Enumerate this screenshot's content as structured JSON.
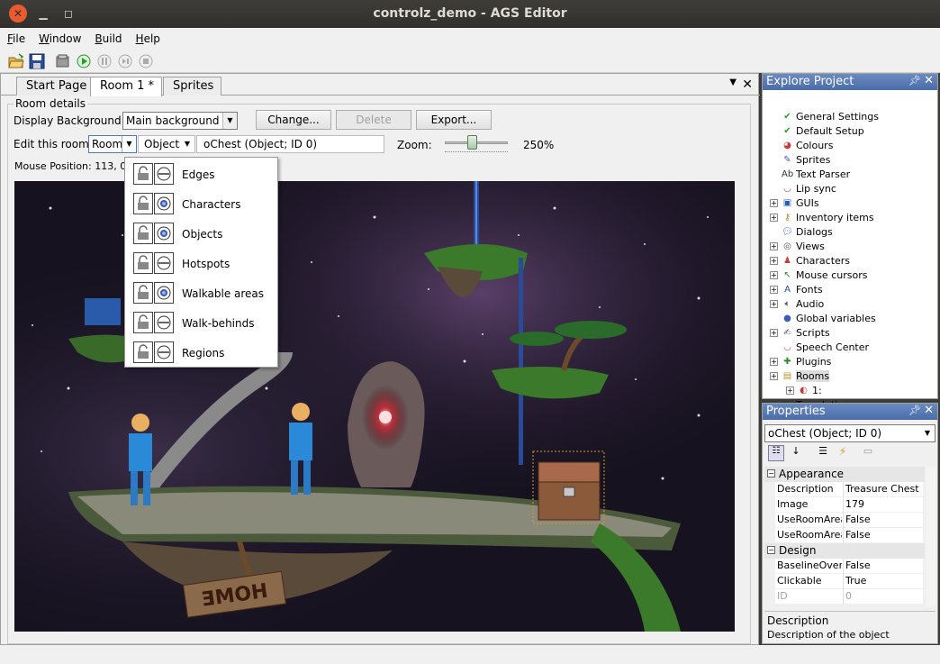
{
  "window": {
    "title": "controlz_demo - AGS Editor"
  },
  "menu": {
    "items": [
      "File",
      "Window",
      "Build",
      "Help"
    ]
  },
  "tabs": [
    {
      "label": "Start Page"
    },
    {
      "label": "Room 1 *"
    },
    {
      "label": "Sprites"
    }
  ],
  "room": {
    "group_label": "Room details",
    "display_bg_label": "Display Background:",
    "display_bg_value": "Main background",
    "change_label": "Change...",
    "delete_label": "Delete",
    "export_label": "Export...",
    "edit_label": "Edit this room's:",
    "edit_layer": "Room",
    "edit_filter": "Objects",
    "selected_object": "oChest (Object; ID 0)",
    "zoom_label": "Zoom:",
    "zoom_value": "250%",
    "zoom_fraction": 0.42,
    "mouse_position": "Mouse Position: 113, 0"
  },
  "layer_menu": [
    {
      "label": "Edges",
      "visible": false
    },
    {
      "label": "Characters",
      "visible": true
    },
    {
      "label": "Objects",
      "visible": true
    },
    {
      "label": "Hotspots",
      "visible": false
    },
    {
      "label": "Walkable areas",
      "visible": true
    },
    {
      "label": "Walk-behinds",
      "visible": false
    },
    {
      "label": "Regions",
      "visible": false
    }
  ],
  "scene": {
    "sign_text": "HOME"
  },
  "explore": {
    "title": "Explore Project",
    "items": [
      {
        "label": "General Settings",
        "icon": "check-icon",
        "expander": false,
        "indent": 0
      },
      {
        "label": "Default Setup",
        "icon": "check-icon",
        "expander": false,
        "indent": 0
      },
      {
        "label": "Colours",
        "icon": "palette-icon",
        "expander": false,
        "indent": 0
      },
      {
        "label": "Sprites",
        "icon": "sprite-icon",
        "expander": false,
        "indent": 0
      },
      {
        "label": "Text Parser",
        "icon": "text-icon",
        "expander": false,
        "indent": 0
      },
      {
        "label": "Lip sync",
        "icon": "lips-icon",
        "expander": false,
        "indent": 0
      },
      {
        "label": "GUIs",
        "icon": "gui-icon",
        "expander": true,
        "indent": 0
      },
      {
        "label": "Inventory items",
        "icon": "key-icon",
        "expander": true,
        "indent": 0
      },
      {
        "label": "Dialogs",
        "icon": "speech-icon",
        "expander": false,
        "indent": 0
      },
      {
        "label": "Views",
        "icon": "eyes-icon",
        "expander": true,
        "indent": 0
      },
      {
        "label": "Characters",
        "icon": "people-icon",
        "expander": true,
        "indent": 0
      },
      {
        "label": "Mouse cursors",
        "icon": "cursor-icon",
        "expander": true,
        "indent": 0
      },
      {
        "label": "Fonts",
        "icon": "font-icon",
        "expander": true,
        "indent": 0
      },
      {
        "label": "Audio",
        "icon": "speaker-icon",
        "expander": true,
        "indent": 0
      },
      {
        "label": "Global variables",
        "icon": "globe-icon",
        "expander": false,
        "indent": 0
      },
      {
        "label": "Scripts",
        "icon": "script-icon",
        "expander": true,
        "indent": 0
      },
      {
        "label": "Speech Center",
        "icon": "speech-center-icon",
        "expander": false,
        "indent": 0
      },
      {
        "label": "Plugins",
        "icon": "plugin-icon",
        "expander": true,
        "indent": 0
      },
      {
        "label": "Rooms",
        "icon": "box-icon",
        "expander": true,
        "indent": 0
      },
      {
        "label": "1:",
        "icon": "room-icon",
        "expander": true,
        "indent": 1
      },
      {
        "label": "Translations",
        "icon": "translate-icon",
        "expander": false,
        "indent": 0
      }
    ]
  },
  "properties": {
    "title": "Properties",
    "object_select": "oChest (Object; ID 0)",
    "categories": [
      {
        "name": "Appearance",
        "rows": [
          {
            "name": "Description",
            "value": "Treasure Chest"
          },
          {
            "name": "Image",
            "value": "179"
          },
          {
            "name": "UseRoomAreaLighting",
            "value": "False"
          },
          {
            "name": "UseRoomAreaScaling",
            "value": "False"
          }
        ]
      },
      {
        "name": "Design",
        "rows": [
          {
            "name": "BaselineOverridden",
            "value": "False"
          },
          {
            "name": "Clickable",
            "value": "True"
          },
          {
            "name": "ID",
            "value": "0"
          }
        ]
      }
    ],
    "help_title": "Description",
    "help_text": "Description of the object"
  }
}
